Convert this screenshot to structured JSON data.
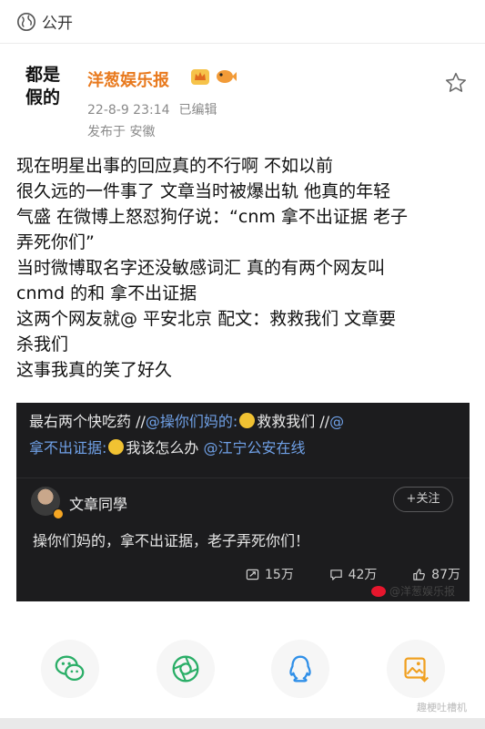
{
  "header": {
    "visibility_label": "公开"
  },
  "post": {
    "avatar_lines": [
      "都是",
      "假的"
    ],
    "author": "洋葱娱乐报",
    "time": "22-8-9 23:14",
    "edited": "已编辑",
    "location": "发布于 安徽",
    "body_lines": [
      "现在明星出事的回应真的不行啊  不如以前",
      "很久远的一件事了 文章当时被爆出轨 他真的年轻",
      "气盛 在微博上怒怼狗仔说：“cnm 拿不出证据 老子",
      "弄死你们”",
      "当时微博取名字还没敏感词汇 真的有两个网友叫",
      "cnmd 的和 拿不出证据",
      "这两个网友就@ 平安北京 配文：救救我们 文章要",
      "杀我们",
      "这事我真的笑了好久"
    ]
  },
  "embed": {
    "caption_prefix": "最右两个快吃药 //",
    "mention1": "@操你们妈的:",
    "caption_mid": "救救我们 //",
    "mention2a": "@",
    "mention2b": "拿不出证据:",
    "caption_end": "我该怎么办 ",
    "mention3": "@江宁公安在线",
    "author": "文章同學",
    "follow": "+关注",
    "text": "操你们妈的，拿不出证据，老子弄死你们！",
    "reposts": "15万",
    "comments": "42万",
    "likes": "87万"
  },
  "watermark": "@洋葱娱乐报",
  "share": [
    "wechat-icon",
    "moments-icon",
    "qq-icon",
    "save-image-icon"
  ],
  "corner_mark": "趣梗吐槽机",
  "colors": {
    "author": "#e8791d",
    "mention": "#6fa0e6",
    "embed_bg": "#1c1c1e"
  }
}
